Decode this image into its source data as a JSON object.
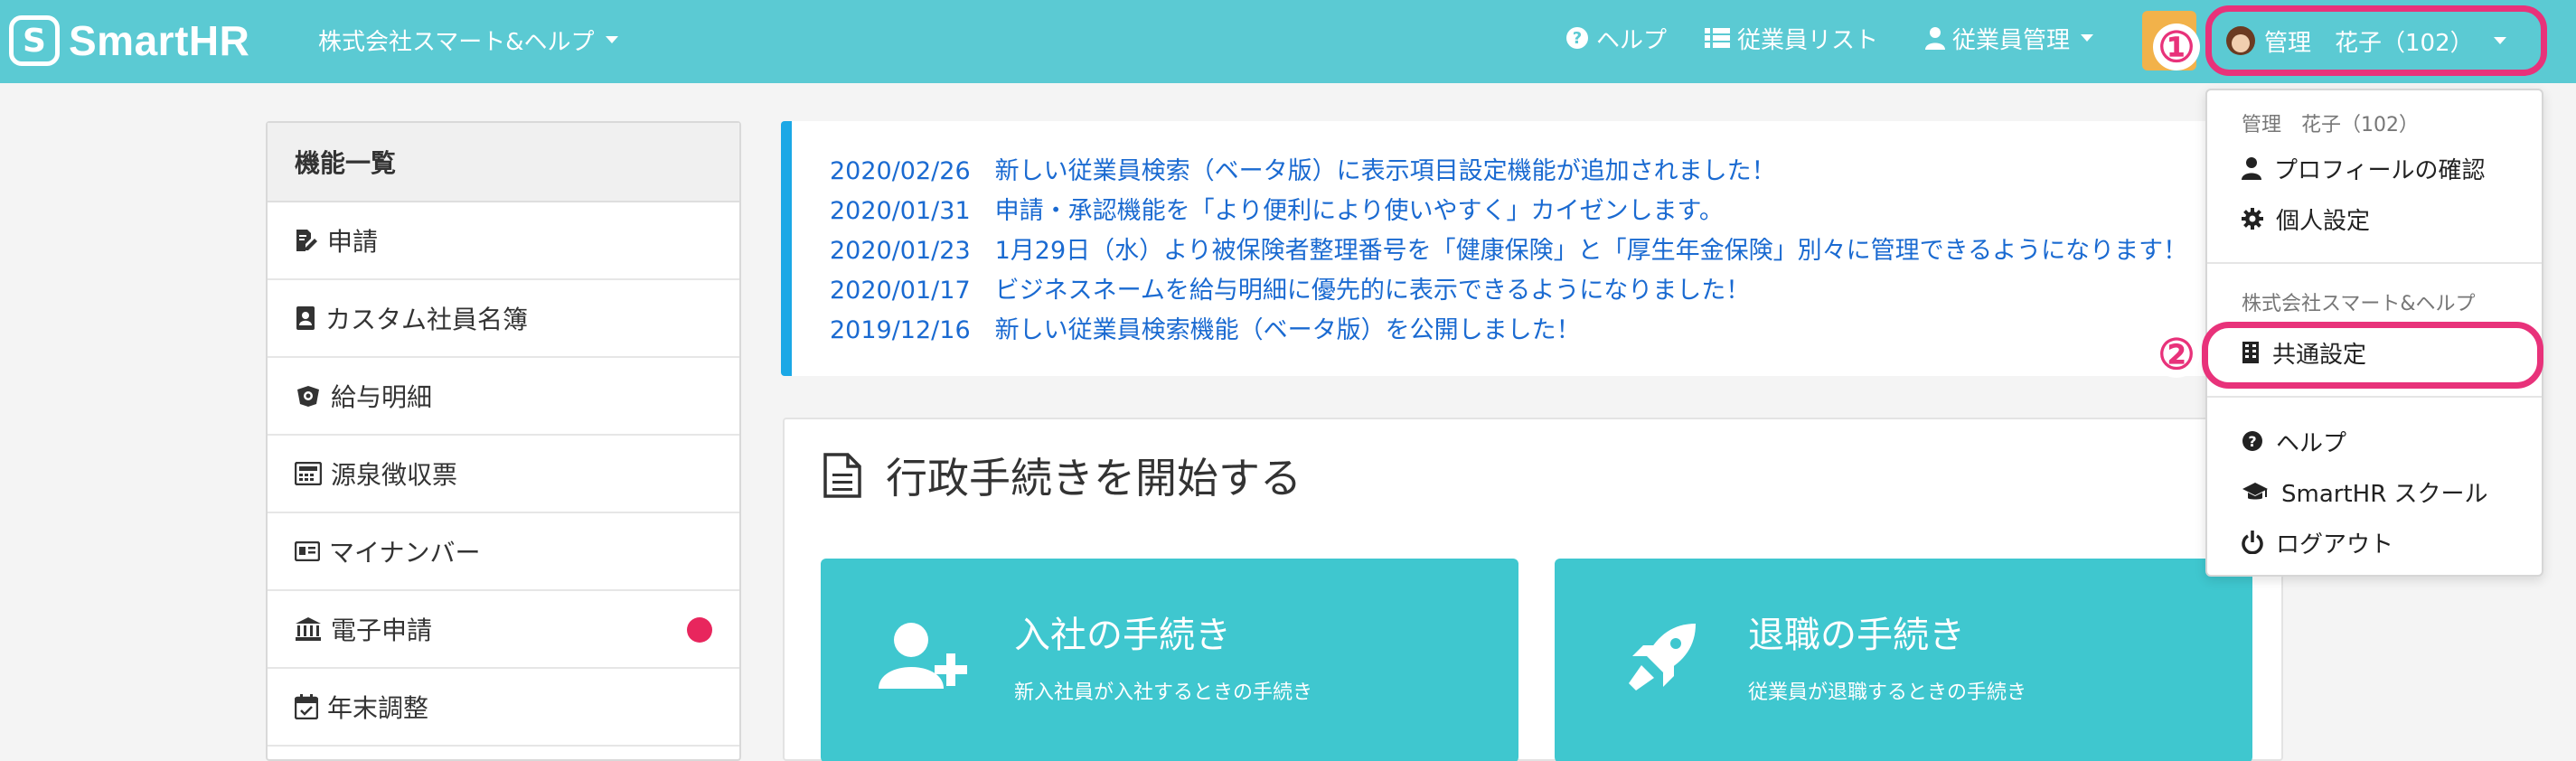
{
  "header": {
    "logo_text": "SmartHR",
    "company": "株式会社スマート&ヘルプ",
    "nav": {
      "help": "ヘルプ",
      "employee_list": "従業員リスト",
      "employee_admin": "従業員管理"
    },
    "user_name": "管理　花子（102）"
  },
  "annotations": {
    "step1": "①",
    "step2": "②"
  },
  "sidebar": {
    "title": "機能一覧",
    "items": [
      {
        "label": "申請",
        "icon": "edit-doc-icon"
      },
      {
        "label": "カスタム社員名簿",
        "icon": "contact-book-icon"
      },
      {
        "label": "給与明細",
        "icon": "wallet-icon"
      },
      {
        "label": "源泉徴収票",
        "icon": "calculator-icon"
      },
      {
        "label": "マイナンバー",
        "icon": "id-card-icon"
      },
      {
        "label": "電子申請",
        "icon": "bank-icon"
      },
      {
        "label": "年末調整",
        "icon": "calendar-check-icon"
      }
    ]
  },
  "news": [
    {
      "date": "2020/02/26",
      "text": "新しい従業員検索（ベータ版）に表示項目設定機能が追加されました！"
    },
    {
      "date": "2020/01/31",
      "text": "申請・承認機能を「より便利により使いやすく」カイゼンします。"
    },
    {
      "date": "2020/01/23",
      "text": "1月29日（水）より被保険者整理番号を「健康保険」と「厚生年金保険」別々に管理できるようになります！"
    },
    {
      "date": "2020/01/17",
      "text": "ビジネスネームを給与明細に優先的に表示できるようになりました！"
    },
    {
      "date": "2019/12/16",
      "text": "新しい従業員検索機能（ベータ版）を公開しました！"
    }
  ],
  "admin": {
    "title": "行政手続きを開始する",
    "tiles": [
      {
        "title": "入社の手続き",
        "sub": "新入社員が入社するときの手続き"
      },
      {
        "title": "退職の手続き",
        "sub": "従業員が退職するときの手続き"
      }
    ]
  },
  "dropdown": {
    "user_label": "管理　花子（102）",
    "profile": "プロフィールの確認",
    "personal": "個人設定",
    "company_label": "株式会社スマート&ヘルプ",
    "common_settings": "共通設定",
    "help": "ヘルプ",
    "school": "SmartHR スクール",
    "logout": "ログアウト"
  },
  "colors": {
    "header": "#5bcad3",
    "accent": "#e8327a",
    "link": "#1a6ad1",
    "tile": "#3fc7cf",
    "news_border": "#1ba8e6"
  }
}
